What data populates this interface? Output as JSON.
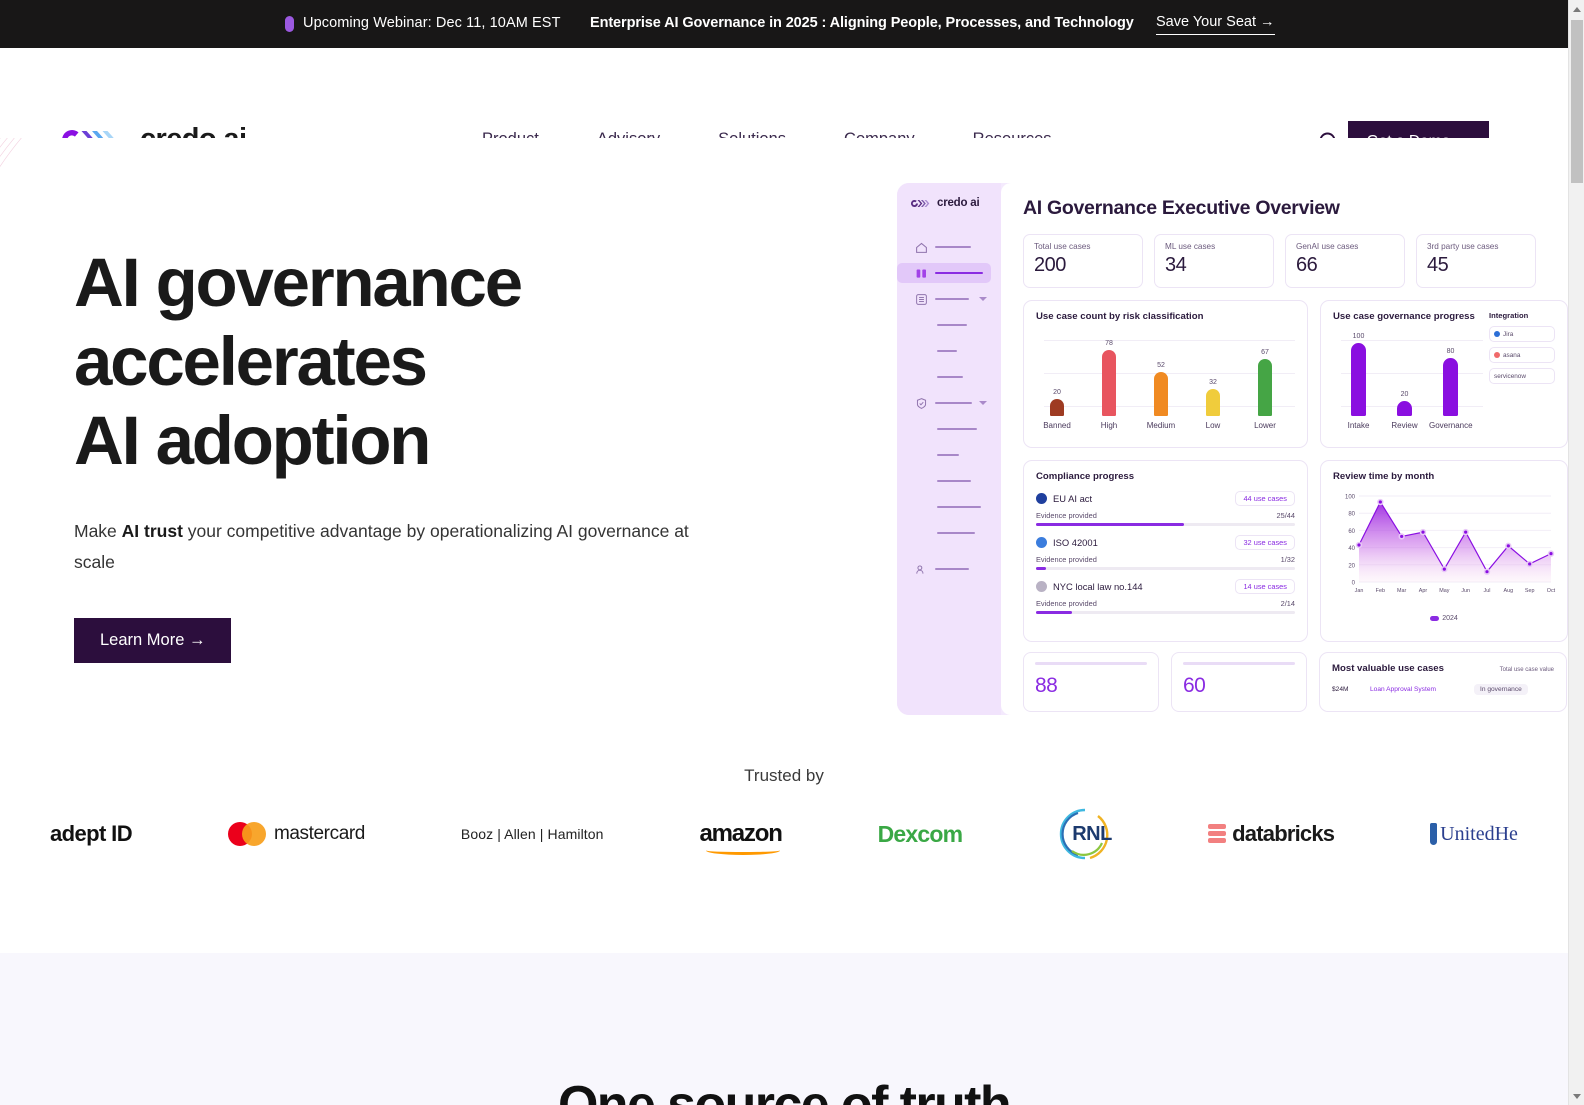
{
  "announcement": {
    "icon": "microphone-icon",
    "left_text": "Upcoming Webinar: Dec 11, 10AM EST",
    "headline": "Enterprise AI Governance in 2025 : Aligning People, Processes, and Technology",
    "cta": "Save Your Seat →"
  },
  "header": {
    "logo_text": "credo ai",
    "nav": [
      {
        "label": "Product"
      },
      {
        "label": "Advisory"
      },
      {
        "label": "Solutions"
      },
      {
        "label": "Company"
      },
      {
        "label": "Resources"
      }
    ],
    "search_icon": "search-icon",
    "demo_button": "Get a Demo  →"
  },
  "hero": {
    "title_line1": "AI governance",
    "title_line2": "accelerates",
    "title_line3": "AI adoption",
    "sub_before": "Make ",
    "sub_bold": "AI trust",
    "sub_after": " your competitive advantage by operationalizing AI governance at scale",
    "cta": "Learn More  →"
  },
  "dashboard": {
    "logo_text": "credo ai",
    "title": "AI Governance Executive Overview",
    "kpis": [
      {
        "label": "Total use cases",
        "value": "200"
      },
      {
        "label": "ML use cases",
        "value": "34"
      },
      {
        "label": "GenAI use cases",
        "value": "66"
      },
      {
        "label": "3rd party use cases",
        "value": "45"
      }
    ],
    "risk_panel": {
      "title": "Use case count by risk classification"
    },
    "gov_panel": {
      "title": "Use case governance progress"
    },
    "integrations": {
      "title": "Integration",
      "items": [
        {
          "label": "Jira",
          "color": "#2c6fd6"
        },
        {
          "label": "asana",
          "color": "#f06a6a"
        },
        {
          "label": "servicenow",
          "color": "#62b5a0"
        }
      ]
    },
    "compliance": {
      "title": "Compliance progress",
      "rows": [
        {
          "name": "EU AI act",
          "chip": "44 use cases",
          "sub": "Evidence provided",
          "ratio": "25/44",
          "pct": 57,
          "dot": "#1f3f9e"
        },
        {
          "name": "ISO 42001",
          "chip": "32 use cases",
          "sub": "Evidence provided",
          "ratio": "1/32",
          "pct": 4,
          "dot": "#3b7ddd"
        },
        {
          "name": "NYC local law no.144",
          "chip": "14 use cases",
          "sub": "Evidence provided",
          "ratio": "2/14",
          "pct": 14,
          "dot": "#b9b2c4"
        }
      ]
    },
    "review_panel": {
      "title": "Review time by month",
      "legend": "2024"
    },
    "mini_cards": [
      {
        "value": "88"
      },
      {
        "value": "60"
      }
    ],
    "most_valuable": {
      "title": "Most valuable use cases",
      "right_label": "Total use case value",
      "row": {
        "value": "$24M",
        "name": "Loan Approval System",
        "status": "In governance"
      }
    }
  },
  "trusted": {
    "label": "Trusted by",
    "logos": [
      {
        "name": "adept ID"
      },
      {
        "name": "mastercard"
      },
      {
        "name": "Booz | Allen | Hamilton"
      },
      {
        "name": "amazon"
      },
      {
        "name": "Dexcom"
      },
      {
        "name": "RNL"
      },
      {
        "name": "databricks"
      },
      {
        "name": "UnitedHe"
      }
    ]
  },
  "next_section": {
    "heading": "One source of truth"
  },
  "colors": {
    "dark_bar": "#181717",
    "brand_purple": "#8a2be2",
    "deep_purple": "#2c0e3d",
    "lavender_bg": "#f4eafd"
  },
  "chart_data": [
    {
      "type": "bar",
      "title": "Use case count by risk classification",
      "categories": [
        "Banned",
        "High",
        "Medium",
        "Low",
        "Lower"
      ],
      "values": [
        20,
        78,
        52,
        32,
        67
      ],
      "colors": [
        "#9e3b22",
        "#e8555f",
        "#f08a22",
        "#f0cc3c",
        "#45a545"
      ],
      "xlabel": "",
      "ylabel": "",
      "ylim": [
        0,
        90
      ],
      "grid": true
    },
    {
      "type": "bar",
      "title": "Use case governance progress",
      "categories": [
        "Intake",
        "Review",
        "Governance"
      ],
      "values": [
        100,
        20,
        80
      ],
      "colors": [
        "#8a0fe0",
        "#8a0fe0",
        "#8a0fe0"
      ],
      "xlabel": "",
      "ylabel": "",
      "ylim": [
        0,
        110
      ],
      "grid": true
    },
    {
      "type": "area",
      "title": "Review time by month",
      "x": [
        "Jan",
        "Feb",
        "Mar",
        "Apr",
        "May",
        "Jun",
        "Jul",
        "Aug",
        "Sep",
        "Oct"
      ],
      "series": [
        {
          "name": "2024",
          "values": [
            43,
            93,
            53,
            58,
            15,
            58,
            12,
            42,
            21,
            33
          ]
        }
      ],
      "yticks": [
        0,
        20,
        40,
        60,
        80,
        100
      ],
      "ylim": [
        0,
        100
      ],
      "xlabel": "",
      "ylabel": "",
      "grid": true,
      "legend_position": "bottom"
    }
  ],
  "scrollbar": {
    "position": "right"
  }
}
